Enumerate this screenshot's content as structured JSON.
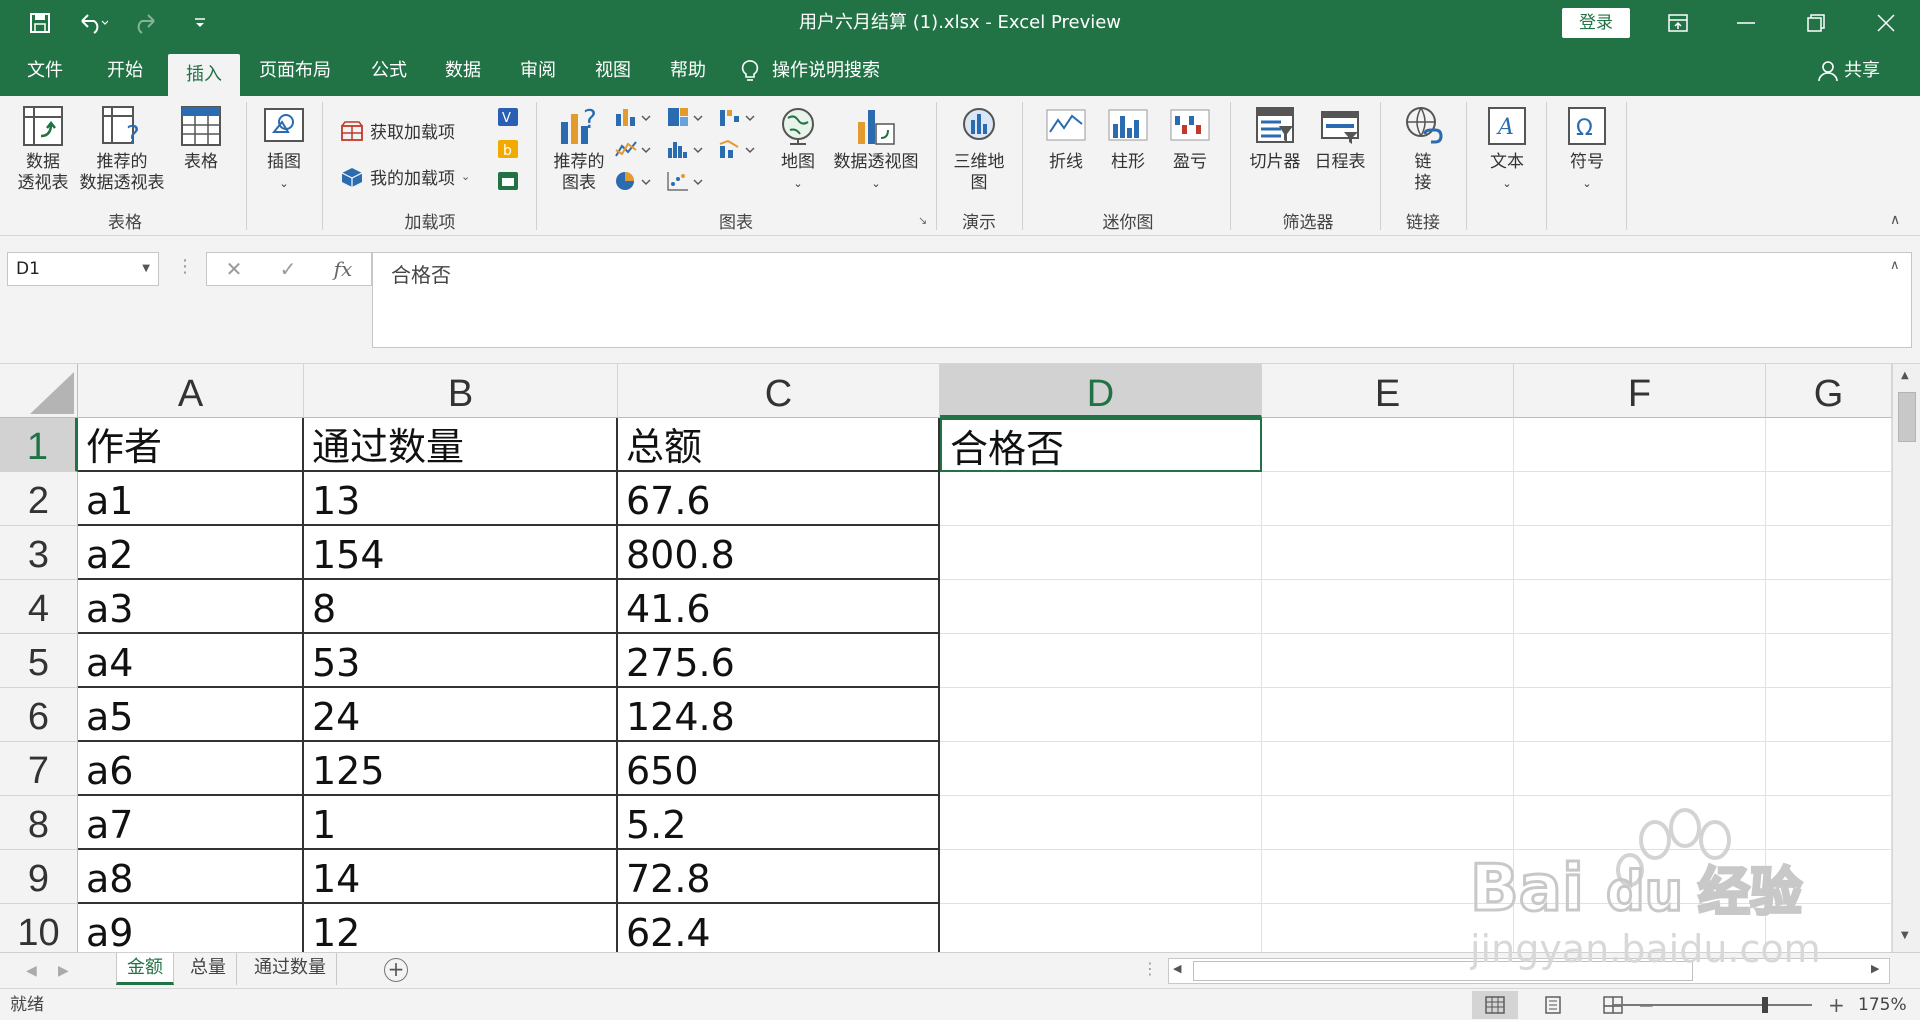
{
  "app": {
    "window_title": "用户六月结算 (1).xlsx  -  Excel Preview",
    "login_label": "登录",
    "share_label": "共享"
  },
  "menu": {
    "tabs": [
      "文件",
      "开始",
      "插入",
      "页面布局",
      "公式",
      "数据",
      "审阅",
      "视图",
      "帮助"
    ],
    "active": "插入",
    "search_label": "操作说明搜索"
  },
  "ribbon": {
    "groups": {
      "tables": "表格",
      "addins": "加载项",
      "charts": "图表",
      "tours": "演示",
      "sparklines": "迷你图",
      "filters": "筛选器",
      "links": "链接"
    },
    "buttons": {
      "pivot_table": [
        "数据",
        "透视表"
      ],
      "recommended_pivot": [
        "推荐的",
        "数据透视表"
      ],
      "table": "表格",
      "illustrations": "插图",
      "get_addins": "获取加载项",
      "my_addins": "我的加载项",
      "recommended_charts": [
        "推荐的",
        "图表"
      ],
      "map": "地图",
      "pivot_chart": "数据透视图",
      "map3d": [
        "三维地",
        "图"
      ],
      "line": "折线",
      "column": "柱形",
      "winloss": "盈亏",
      "slicer": "切片器",
      "timeline": "日程表",
      "link": [
        "链",
        "接"
      ],
      "text": "文本",
      "symbol": "符号"
    }
  },
  "formula_bar": {
    "name_box": "D1",
    "content": "合格否"
  },
  "sheet": {
    "columns": [
      "A",
      "B",
      "C",
      "D",
      "E",
      "F",
      "G"
    ],
    "selected_column": "D",
    "selected_row": "1",
    "rows": [
      {
        "num": "1",
        "cells": [
          "作者",
          "通过数量",
          "总额",
          "合格否"
        ]
      },
      {
        "num": "2",
        "cells": [
          "a1",
          "13",
          "67.6",
          ""
        ]
      },
      {
        "num": "3",
        "cells": [
          "a2",
          "154",
          "800.8",
          ""
        ]
      },
      {
        "num": "4",
        "cells": [
          "a3",
          "8",
          "41.6",
          ""
        ]
      },
      {
        "num": "5",
        "cells": [
          "a4",
          "53",
          "275.6",
          ""
        ]
      },
      {
        "num": "6",
        "cells": [
          "a5",
          "24",
          "124.8",
          ""
        ]
      },
      {
        "num": "7",
        "cells": [
          "a6",
          "125",
          "650",
          ""
        ]
      },
      {
        "num": "8",
        "cells": [
          "a7",
          "1",
          "5.2",
          ""
        ]
      },
      {
        "num": "9",
        "cells": [
          "a8",
          "14",
          "72.8",
          ""
        ]
      },
      {
        "num": "10",
        "cells": [
          "a9",
          "12",
          "62.4",
          ""
        ]
      }
    ]
  },
  "sheet_tabs": {
    "tabs": [
      "金额",
      "总量",
      "通过数量"
    ],
    "active": "金额",
    "add_label": "+"
  },
  "status": {
    "text": "就绪",
    "zoom": "175%"
  },
  "watermark": {
    "brand": "Bai",
    "brand2": "du",
    "cn": "经验",
    "url": "jingyan.baidu.com"
  },
  "colors": {
    "accent": "#217346",
    "ribbon_bg": "#f3f3f3"
  }
}
